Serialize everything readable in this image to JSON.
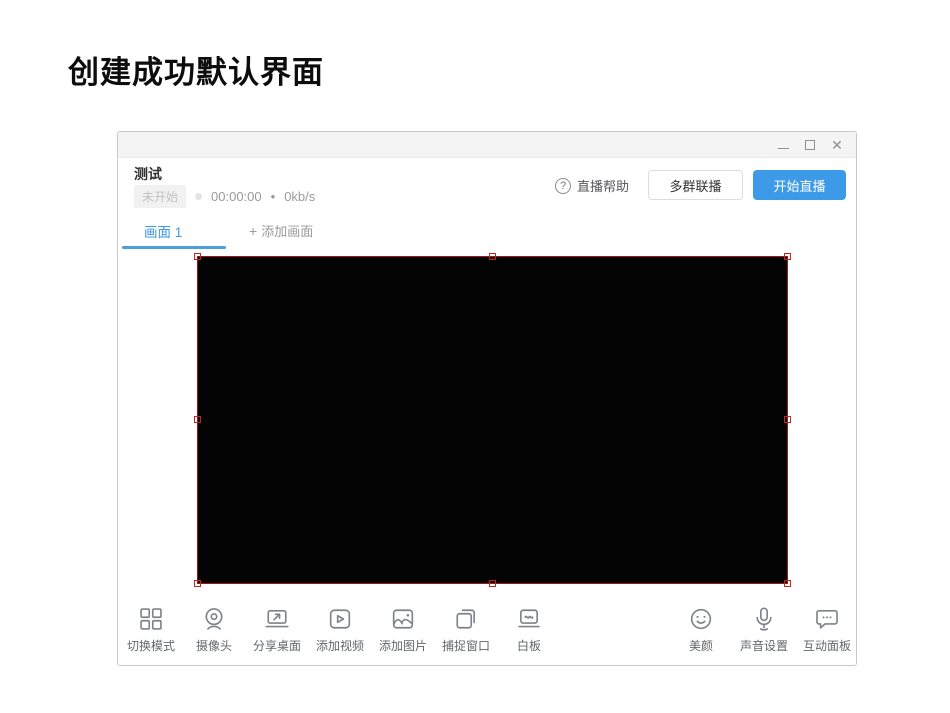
{
  "page": {
    "title": "创建成功默认界面"
  },
  "window": {
    "controls": {
      "close_glyph": "✕"
    },
    "header": {
      "stream_title": "测试",
      "status_badge": "未开始",
      "timer": "00:00:00",
      "separator": "•",
      "bitrate": "0kb/s",
      "help_icon_glyph": "?",
      "help_label": "直播帮助",
      "multi_group_button": "多群联播",
      "start_button": "开始直播"
    },
    "tabs": {
      "active_label": "画面 1",
      "add_plus": "+",
      "add_label": "添加画面"
    },
    "toolbar": {
      "left": [
        {
          "label": "切换模式",
          "icon": "grid-icon"
        },
        {
          "label": "摄像头",
          "icon": "camera-icon"
        },
        {
          "label": "分享桌面",
          "icon": "share-desktop-icon"
        },
        {
          "label": "添加视频",
          "icon": "add-video-icon"
        },
        {
          "label": "添加图片",
          "icon": "add-image-icon"
        },
        {
          "label": "捕捉窗口",
          "icon": "capture-window-icon"
        },
        {
          "label": "白板",
          "icon": "whiteboard-icon"
        }
      ],
      "right": [
        {
          "label": "美颜",
          "icon": "beauty-face-icon"
        },
        {
          "label": "声音设置",
          "icon": "microphone-icon"
        },
        {
          "label": "互动面板",
          "icon": "chat-panel-icon"
        }
      ]
    },
    "colors": {
      "accent_blue": "#3d9ae8",
      "selection_red": "#a31212",
      "titlebar_gray": "#f4f4f5"
    }
  }
}
